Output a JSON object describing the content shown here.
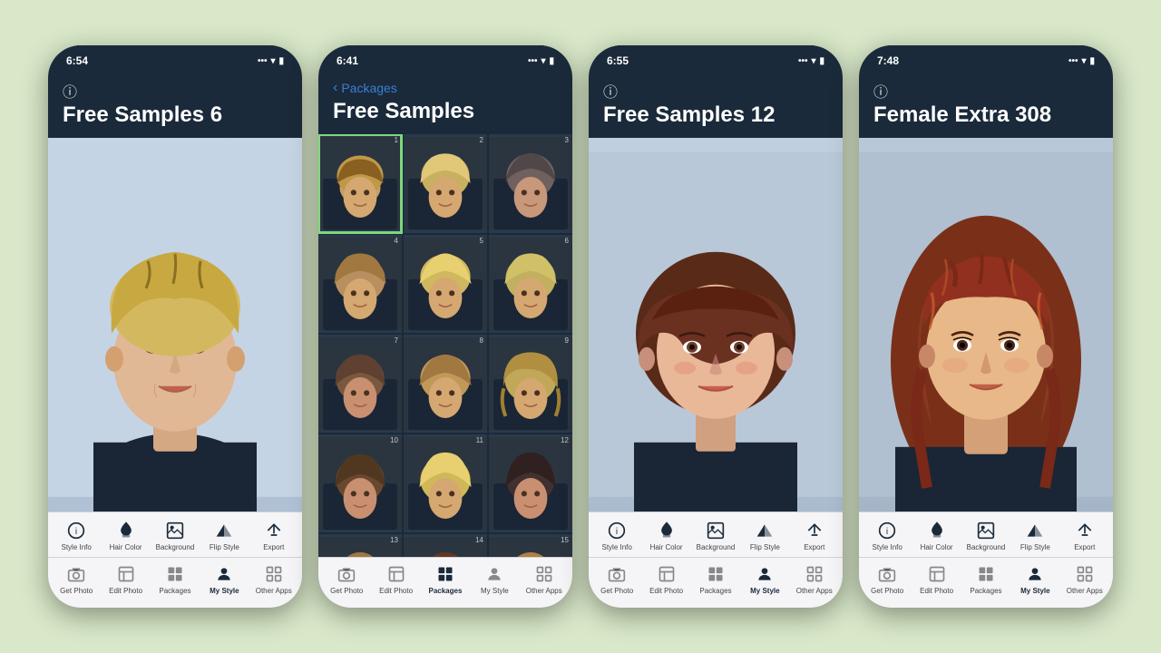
{
  "background": "#d8e8c8",
  "phones": [
    {
      "id": "phone1",
      "time": "6:54",
      "title": "Free Samples 6",
      "portrait_style": "short-blonde",
      "toolbar_top": [
        {
          "id": "style-info",
          "icon": "ℹ",
          "label": "Style Info",
          "active": false
        },
        {
          "id": "hair-color",
          "icon": "bucket",
          "label": "Hair Color",
          "active": false
        },
        {
          "id": "background",
          "icon": "background",
          "label": "Background",
          "active": false
        },
        {
          "id": "flip-style",
          "icon": "flip",
          "label": "Flip Style",
          "active": false
        },
        {
          "id": "export",
          "icon": "export",
          "label": "Export",
          "active": false
        }
      ],
      "toolbar_bottom": [
        {
          "id": "get-photo",
          "icon": "camera",
          "label": "Get Photo",
          "active": false
        },
        {
          "id": "edit-photo",
          "icon": "edit-photo",
          "label": "Edit Photo",
          "active": false
        },
        {
          "id": "packages",
          "icon": "packages",
          "label": "Packages",
          "active": false
        },
        {
          "id": "my-style",
          "icon": "my-style",
          "label": "My Style",
          "active": true
        },
        {
          "id": "other-apps",
          "icon": "other-apps",
          "label": "Other Apps",
          "active": false
        }
      ]
    },
    {
      "id": "phone2",
      "time": "6:41",
      "nav_back": "Packages",
      "title": "Free Samples",
      "view": "grid",
      "grid_count": 15,
      "selected_cell": 1,
      "toolbar_bottom": [
        {
          "id": "get-photo",
          "icon": "camera",
          "label": "Get Photo",
          "active": false
        },
        {
          "id": "edit-photo",
          "icon": "edit-photo",
          "label": "Edit Photo",
          "active": false
        },
        {
          "id": "packages",
          "icon": "packages",
          "label": "Packages",
          "active": true
        },
        {
          "id": "my-style",
          "icon": "my-style",
          "label": "My Style",
          "active": false
        },
        {
          "id": "other-apps",
          "icon": "other-apps",
          "label": "Other Apps",
          "active": false
        }
      ]
    },
    {
      "id": "phone3",
      "time": "6:55",
      "title": "Free Samples 12",
      "portrait_style": "brown-bob",
      "toolbar_top": [
        {
          "id": "style-info",
          "icon": "ℹ",
          "label": "Style Info",
          "active": false
        },
        {
          "id": "hair-color",
          "icon": "bucket",
          "label": "Hair Color",
          "active": false
        },
        {
          "id": "background",
          "icon": "background",
          "label": "Background",
          "active": false
        },
        {
          "id": "flip-style",
          "icon": "flip",
          "label": "Flip Style",
          "active": false
        },
        {
          "id": "export",
          "icon": "export",
          "label": "Export",
          "active": false
        }
      ],
      "toolbar_bottom": [
        {
          "id": "get-photo",
          "icon": "camera",
          "label": "Get Photo",
          "active": false
        },
        {
          "id": "edit-photo",
          "icon": "edit-photo",
          "label": "Edit Photo",
          "active": false
        },
        {
          "id": "packages",
          "icon": "packages",
          "label": "Packages",
          "active": false
        },
        {
          "id": "my-style",
          "icon": "my-style",
          "label": "My Style",
          "active": true
        },
        {
          "id": "other-apps",
          "icon": "other-apps",
          "label": "Other Apps",
          "active": false
        }
      ]
    },
    {
      "id": "phone4",
      "time": "7:48",
      "title": "Female Extra 308",
      "portrait_style": "auburn-long",
      "toolbar_top": [
        {
          "id": "style-info",
          "icon": "ℹ",
          "label": "Style Info",
          "active": false
        },
        {
          "id": "hair-color",
          "icon": "bucket",
          "label": "Hair Color",
          "active": false
        },
        {
          "id": "background",
          "icon": "background",
          "label": "Background",
          "active": false
        },
        {
          "id": "flip-style",
          "icon": "flip",
          "label": "Flip Style",
          "active": false
        },
        {
          "id": "export",
          "icon": "export",
          "label": "Export",
          "active": false
        }
      ],
      "toolbar_bottom": [
        {
          "id": "get-photo",
          "icon": "camera",
          "label": "Get Photo",
          "active": false
        },
        {
          "id": "edit-photo",
          "icon": "edit-photo",
          "label": "Edit Photo",
          "active": false
        },
        {
          "id": "packages",
          "icon": "packages",
          "label": "Packages",
          "active": false
        },
        {
          "id": "my-style",
          "icon": "my-style",
          "label": "My Style",
          "active": true
        },
        {
          "id": "other-apps",
          "icon": "other-apps",
          "label": "Other Apps",
          "active": false
        }
      ]
    }
  ],
  "labels": {
    "style_info": "Style Info",
    "hair_color": "Hair Color",
    "background": "Background",
    "flip_style": "Flip Style",
    "export": "Export",
    "get_photo": "Get Photo",
    "edit_photo": "Edit Photo",
    "packages": "Packages",
    "my_style": "My Style",
    "other_apps": "Other Apps"
  }
}
